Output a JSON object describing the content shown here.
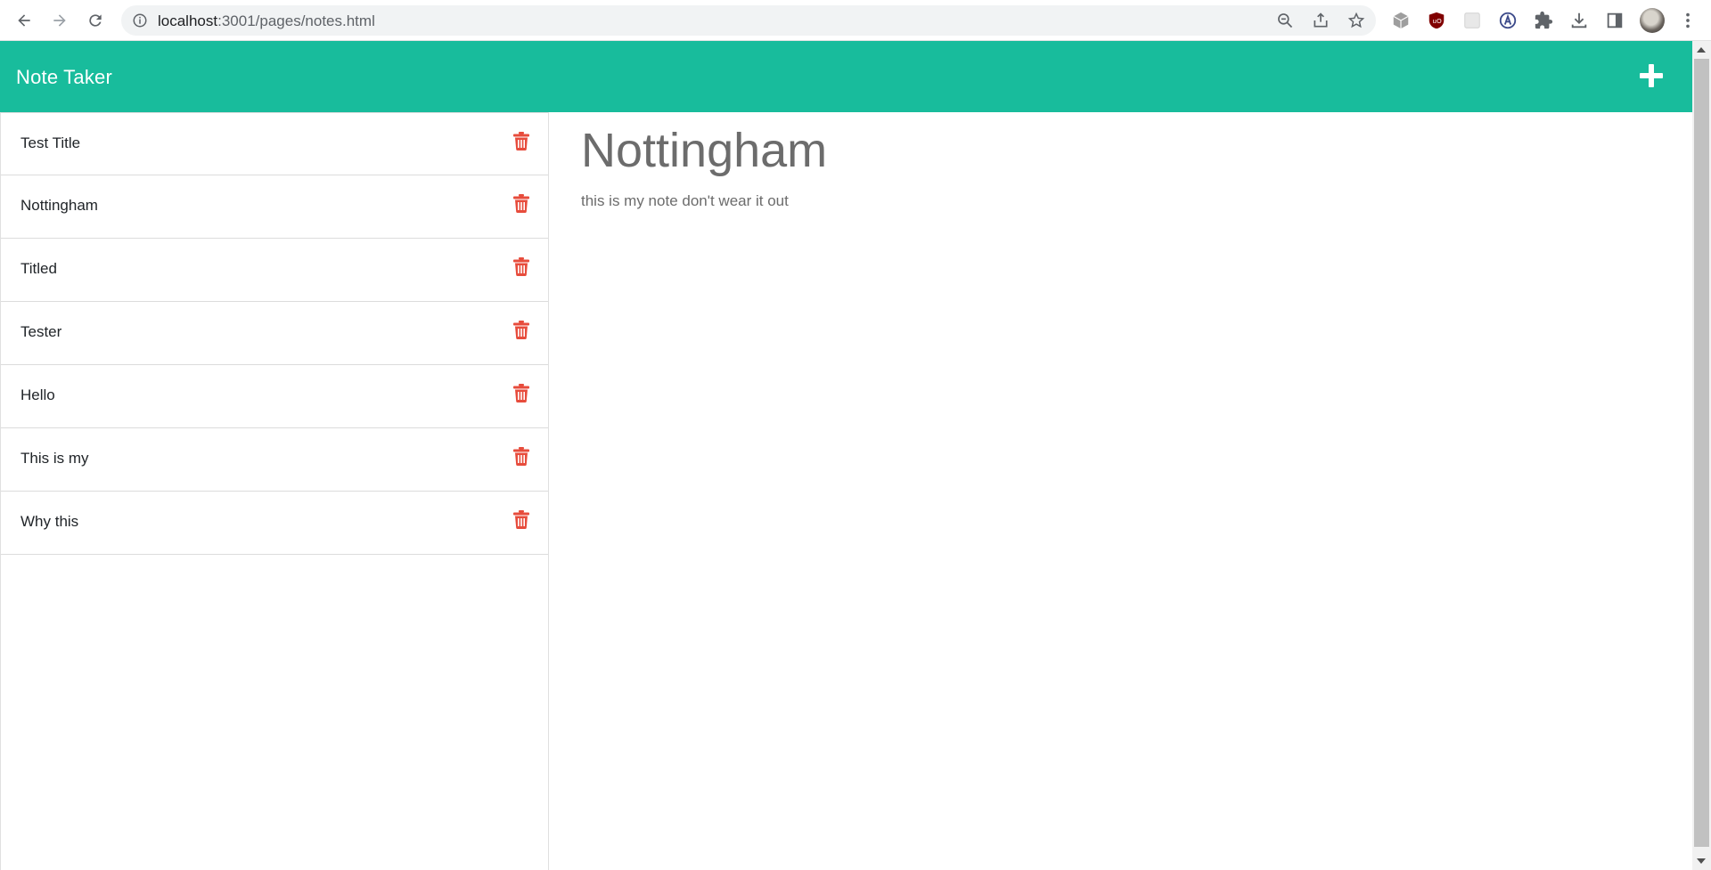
{
  "browser": {
    "url_host": "localhost",
    "url_path": ":3001/pages/notes.html"
  },
  "app": {
    "title": "Note Taker",
    "accent_color": "#18bc9c",
    "delete_color": "#e74c3c"
  },
  "notes": [
    {
      "title": "Test Title"
    },
    {
      "title": "Nottingham"
    },
    {
      "title": "Titled"
    },
    {
      "title": "Tester"
    },
    {
      "title": "Hello"
    },
    {
      "title": "This is my"
    },
    {
      "title": "Why this"
    }
  ],
  "active_note": {
    "title": "Nottingham",
    "text": "this is my note don't wear it out"
  }
}
